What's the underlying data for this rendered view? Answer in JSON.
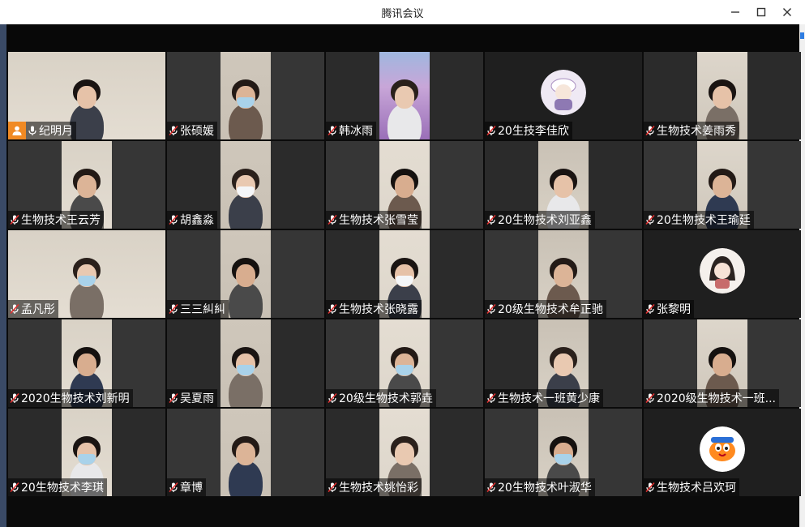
{
  "window": {
    "title": "腾讯会议"
  },
  "participants": [
    {
      "name": "纪明月",
      "host": true,
      "scene": "room",
      "wide": true,
      "masked": false
    },
    {
      "name": "张硕媛",
      "host": false,
      "scene": "person",
      "masked": true
    },
    {
      "name": "韩冰雨",
      "host": false,
      "scene": "person",
      "masked": false,
      "lavender": true
    },
    {
      "name": "20生技李佳欣",
      "host": false,
      "scene": "avatar",
      "avatar": "anime-avatar-icon"
    },
    {
      "name": "生物技术姜雨秀",
      "host": false,
      "scene": "person",
      "masked": false
    },
    {
      "name": "生物技术王云芳",
      "host": false,
      "scene": "person",
      "masked": false
    },
    {
      "name": "胡鑫淼",
      "host": false,
      "scene": "person",
      "masked": true
    },
    {
      "name": "生物技术张雪莹",
      "host": false,
      "scene": "person",
      "masked": false
    },
    {
      "name": "20生物技术刘亚鑫",
      "host": false,
      "scene": "person",
      "masked": false
    },
    {
      "name": "20生物技术王瑜廷",
      "host": false,
      "scene": "person",
      "masked": false
    },
    {
      "name": "孟凡彤",
      "host": false,
      "scene": "room",
      "wide": true,
      "masked": true
    },
    {
      "name": "三三糾糾",
      "host": false,
      "scene": "person",
      "masked": false
    },
    {
      "name": "生物技术张晓露",
      "host": false,
      "scene": "person",
      "masked": true
    },
    {
      "name": "20级生物技术牟正驰",
      "host": false,
      "scene": "person",
      "masked": false
    },
    {
      "name": "张黎明",
      "host": false,
      "scene": "avatar",
      "avatar": "anime-girl-avatar-icon"
    },
    {
      "name": "2020生物技术刘新明",
      "host": false,
      "scene": "person",
      "masked": false
    },
    {
      "name": "吴夏雨",
      "host": false,
      "scene": "person",
      "masked": true
    },
    {
      "name": "20级生物技术郭垚",
      "host": false,
      "scene": "person",
      "masked": true
    },
    {
      "name": "生物技术一班黄少康",
      "host": false,
      "scene": "person",
      "masked": false
    },
    {
      "name": "2020级生物技术一班...",
      "host": false,
      "scene": "person",
      "masked": false
    },
    {
      "name": "20生物技术李琪",
      "host": false,
      "scene": "person",
      "masked": true
    },
    {
      "name": "章博",
      "host": false,
      "scene": "person",
      "masked": false
    },
    {
      "name": "生物技术姚怡彩",
      "host": false,
      "scene": "person",
      "masked": false
    },
    {
      "name": "20生物技术叶淑华",
      "host": false,
      "scene": "person",
      "masked": true
    },
    {
      "name": "生物技术吕欢珂",
      "host": false,
      "scene": "avatar",
      "avatar": "cartoon-bird-avatar-icon"
    }
  ]
}
